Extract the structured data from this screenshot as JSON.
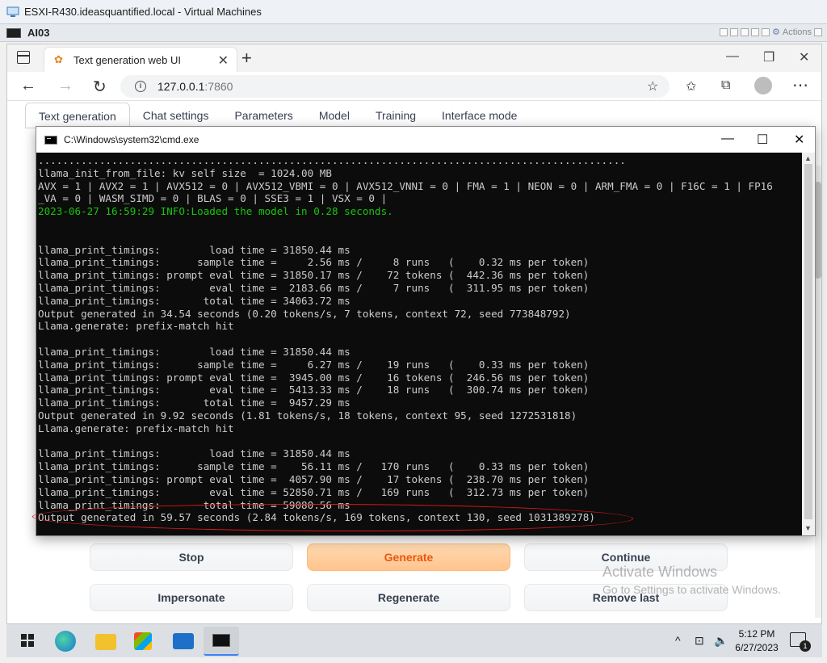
{
  "vsphere": {
    "window_title": "ESXI-R430.ideasquantified.local - Virtual Machines",
    "vm_name": "AI03",
    "actions_label": "Actions"
  },
  "browser": {
    "tab_title": "Text generation web UI",
    "url_host": "127.0.0.1",
    "url_port": ":7860"
  },
  "webui": {
    "tabs": [
      "Text generation",
      "Chat settings",
      "Parameters",
      "Model",
      "Training",
      "Interface mode"
    ],
    "active_tab": "Text generation",
    "buttons": {
      "stop": "Stop",
      "generate": "Generate",
      "continue": "Continue",
      "impersonate": "Impersonate",
      "regenerate": "Regenerate",
      "remove_last": "Remove last"
    }
  },
  "watermark": {
    "line1": "Activate Windows",
    "line2": "Go to Settings to activate Windows."
  },
  "cmd": {
    "title": "C:\\Windows\\system32\\cmd.exe",
    "lines": [
      {
        "text": "................................................................................................",
        "color": "#cccccc"
      },
      {
        "text": "llama_init_from_file: kv self size  = 1024.00 MB",
        "color": "#cccccc"
      },
      {
        "text": "AVX = 1 | AVX2 = 1 | AVX512 = 0 | AVX512_VBMI = 0 | AVX512_VNNI = 0 | FMA = 1 | NEON = 0 | ARM_FMA = 0 | F16C = 1 | FP16",
        "color": "#cccccc"
      },
      {
        "text": "_VA = 0 | WASM_SIMD = 0 | BLAS = 0 | SSE3 = 1 | VSX = 0 |",
        "color": "#cccccc"
      },
      {
        "text": "2023-06-27 16:59:29 INFO:Loaded the model in 0.28 seconds.",
        "color": "#16c60c"
      },
      {
        "text": "",
        "color": "#cccccc"
      },
      {
        "text": "",
        "color": "#cccccc"
      },
      {
        "text": "llama_print_timings:        load time = 31850.44 ms",
        "color": "#cccccc"
      },
      {
        "text": "llama_print_timings:      sample time =     2.56 ms /     8 runs   (    0.32 ms per token)",
        "color": "#cccccc"
      },
      {
        "text": "llama_print_timings: prompt eval time = 31850.17 ms /    72 tokens (  442.36 ms per token)",
        "color": "#cccccc"
      },
      {
        "text": "llama_print_timings:        eval time =  2183.66 ms /     7 runs   (  311.95 ms per token)",
        "color": "#cccccc"
      },
      {
        "text": "llama_print_timings:       total time = 34063.72 ms",
        "color": "#cccccc"
      },
      {
        "text": "Output generated in 34.54 seconds (0.20 tokens/s, 7 tokens, context 72, seed 773848792)",
        "color": "#cccccc"
      },
      {
        "text": "Llama.generate: prefix-match hit",
        "color": "#cccccc"
      },
      {
        "text": "",
        "color": "#cccccc"
      },
      {
        "text": "llama_print_timings:        load time = 31850.44 ms",
        "color": "#cccccc"
      },
      {
        "text": "llama_print_timings:      sample time =     6.27 ms /    19 runs   (    0.33 ms per token)",
        "color": "#cccccc"
      },
      {
        "text": "llama_print_timings: prompt eval time =  3945.00 ms /    16 tokens (  246.56 ms per token)",
        "color": "#cccccc"
      },
      {
        "text": "llama_print_timings:        eval time =  5413.33 ms /    18 runs   (  300.74 ms per token)",
        "color": "#cccccc"
      },
      {
        "text": "llama_print_timings:       total time =  9457.29 ms",
        "color": "#cccccc"
      },
      {
        "text": "Output generated in 9.92 seconds (1.81 tokens/s, 18 tokens, context 95, seed 1272531818)",
        "color": "#cccccc"
      },
      {
        "text": "Llama.generate: prefix-match hit",
        "color": "#cccccc"
      },
      {
        "text": "",
        "color": "#cccccc"
      },
      {
        "text": "llama_print_timings:        load time = 31850.44 ms",
        "color": "#cccccc"
      },
      {
        "text": "llama_print_timings:      sample time =    56.11 ms /   170 runs   (    0.33 ms per token)",
        "color": "#cccccc"
      },
      {
        "text": "llama_print_timings: prompt eval time =  4057.90 ms /    17 tokens (  238.70 ms per token)",
        "color": "#cccccc"
      },
      {
        "text": "llama_print_timings:        eval time = 52850.71 ms /   169 runs   (  312.73 ms per token)",
        "color": "#cccccc"
      },
      {
        "text": "llama_print_timings:       total time = 59080.56 ms",
        "color": "#cccccc"
      },
      {
        "text": "Output generated in 59.57 seconds (2.84 tokens/s, 169 tokens, context 130, seed 1031389278)",
        "color": "#cccccc"
      }
    ]
  },
  "taskbar": {
    "time": "5:12 PM",
    "date": "6/27/2023",
    "notifications": "1"
  }
}
